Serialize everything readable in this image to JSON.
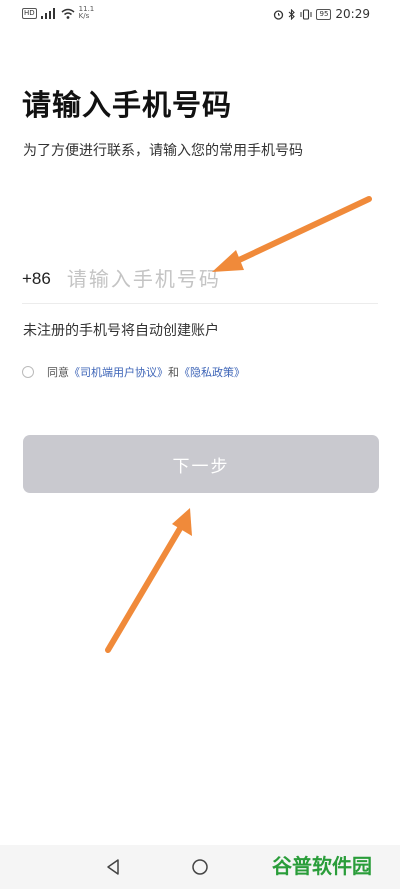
{
  "status_bar": {
    "hd_badge": "HD",
    "net_speed_value": "11.1",
    "net_speed_unit": "K/s",
    "battery": "95",
    "time": "20:29"
  },
  "title": "请输入手机号码",
  "subtitle": "为了方便进行联系，请输入您的常用手机号码",
  "phone": {
    "prefix": "+86",
    "value": "",
    "placeholder": "请输入手机号码"
  },
  "hint": "未注册的手机号将自动创建账户",
  "agreement": {
    "checked": false,
    "prefix": "同意",
    "user_agreement": "《司机端用户协议》",
    "joiner": "和",
    "privacy_policy": "《隐私政策》"
  },
  "next_button": {
    "label": "下一步",
    "enabled": false
  },
  "colors": {
    "annotation_arrow": "#f08a3a",
    "button_disabled": "#c9c9cf",
    "link": "#3d64b7",
    "watermark": "#2a9d3a"
  },
  "navigation": {
    "icons": [
      "back-icon",
      "home-icon"
    ]
  },
  "watermark": "谷普软件园"
}
